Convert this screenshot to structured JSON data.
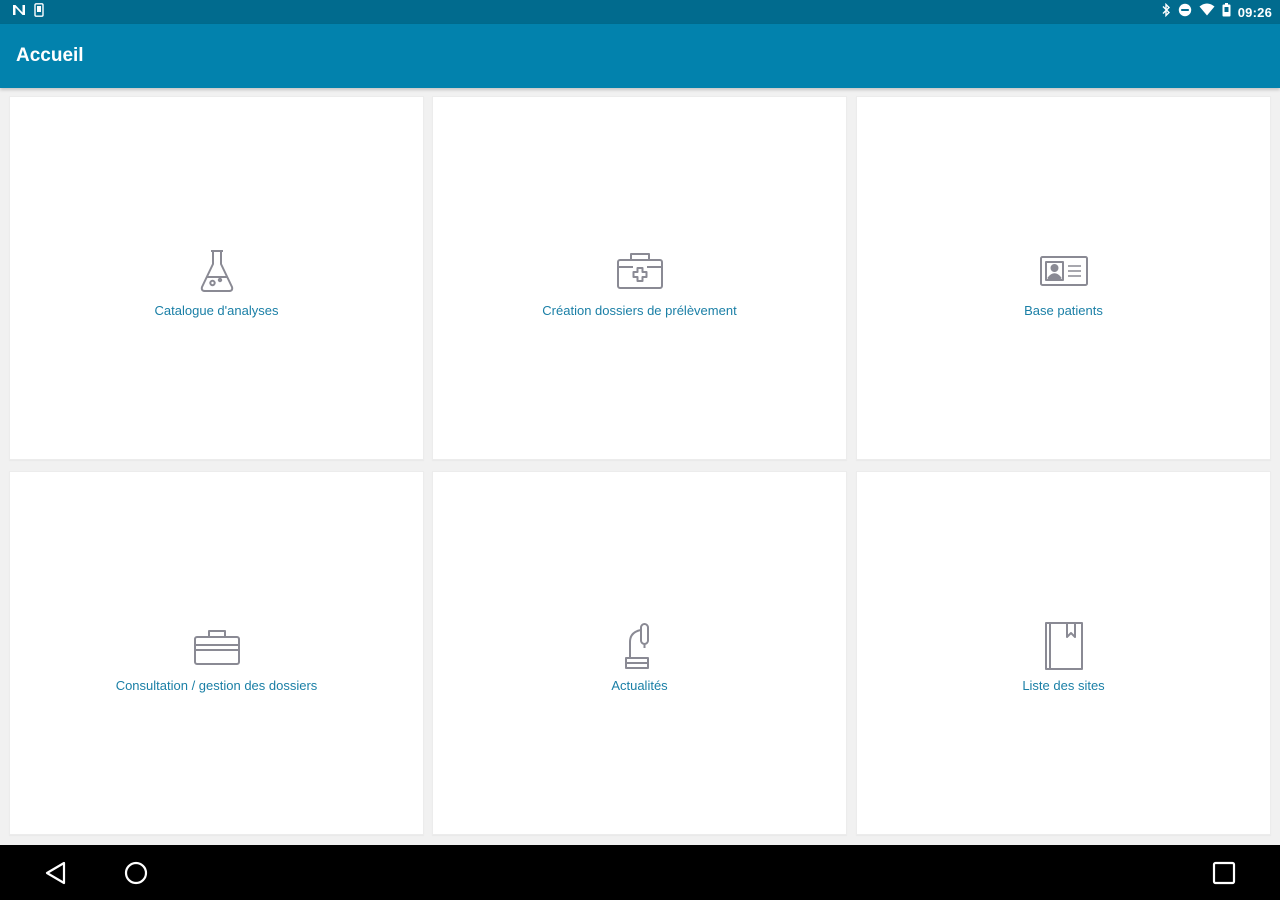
{
  "status_bar": {
    "time": "09:26",
    "left_icons": [
      "n-notification-icon",
      "phone-notification-icon"
    ],
    "right_icons": [
      "bluetooth-icon",
      "do-not-disturb-icon",
      "wifi-icon",
      "battery-icon"
    ]
  },
  "app_bar": {
    "title": "Accueil"
  },
  "tiles": [
    {
      "label": "Catalogue d'analyses",
      "icon": "flask-icon"
    },
    {
      "label": "Création dossiers de prélèvement",
      "icon": "medical-kit-icon"
    },
    {
      "label": "Base patients",
      "icon": "id-card-icon"
    },
    {
      "label": "Consultation / gestion des dossiers",
      "icon": "briefcase-icon"
    },
    {
      "label": "Actualités",
      "icon": "microscope-icon"
    },
    {
      "label": "Liste des sites",
      "icon": "bookmark-book-icon"
    }
  ],
  "nav_bar": {
    "buttons": [
      "back-icon",
      "home-icon",
      "recents-icon"
    ]
  },
  "colors": {
    "status_bar_bg": "#016b8e",
    "app_bar_bg": "#0282ad",
    "label_text": "#1a7fa6",
    "icon_stroke": "#8a8a94",
    "background": "#f1f1f1"
  }
}
